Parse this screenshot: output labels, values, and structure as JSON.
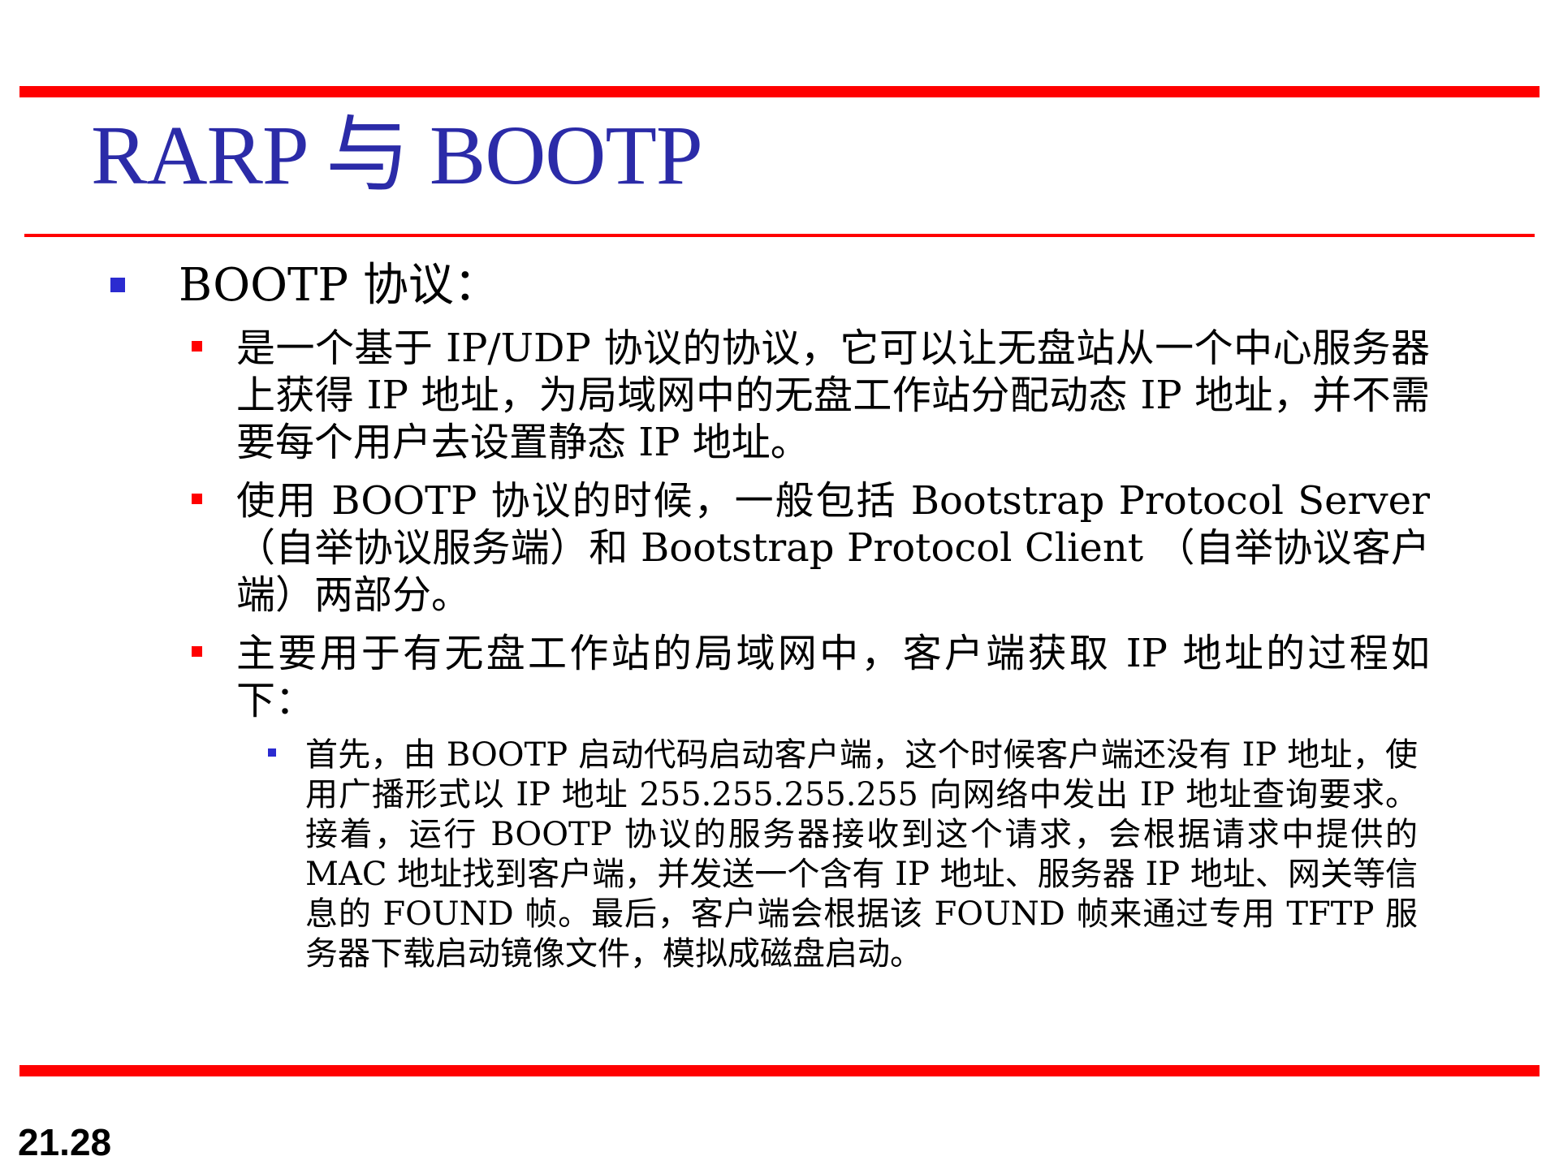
{
  "slide": {
    "title": "RARP 与 BOOTP",
    "page_number": "21.28",
    "colors": {
      "rule": "#ff0000",
      "title": "#2b2ba8",
      "level1_marker": "#2b2bd0",
      "level2_marker": "#ff0000",
      "level3_marker": "#2b2bd0"
    }
  },
  "content": {
    "heading": "BOOTP 协议：",
    "items": [
      {
        "text": "是一个基于 IP/UDP 协议的协议，它可以让无盘站从一个中心服务器上获得 IP 地址，为局域网中的无盘工作站分配动态 IP 地址，并不需要每个用户去设置静态 IP 地址。"
      },
      {
        "text": "使用 BOOTP 协议的时候，一般包括 Bootstrap Protocol Server（自举协议服务端）和 Bootstrap Protocol Client （自举协议客户端）两部分。"
      },
      {
        "text": "主要用于有无盘工作站的局域网中，客户端获取 IP 地址的过程如下："
      }
    ],
    "subitems": [
      {
        "text": "首先，由 BOOTP 启动代码启动客户端，这个时候客户端还没有 IP 地址，使用广播形式以 IP 地址 255.255.255.255 向网络中发出 IP 地址查询要求。接着，运行 BOOTP 协议的服务器接收到这个请求，会根据请求中提供的 MAC 地址找到客户端，并发送一个含有 IP 地址、服务器 IP 地址、网关等信息的 FOUND 帧。最后，客户端会根据该 FOUND 帧来通过专用 TFTP 服务器下载启动镜像文件，模拟成磁盘启动。"
      }
    ]
  }
}
